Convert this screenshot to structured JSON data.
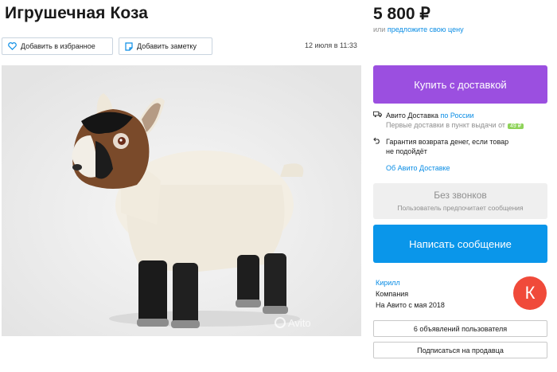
{
  "listing": {
    "title": "Игрушечная Коза",
    "price": "5 800 ₽",
    "offer_prefix": "или",
    "offer_link": "предложите свою цену",
    "date": "12 июля в 11:33",
    "photo_watermark": "Avito"
  },
  "actions": {
    "favorite_label": "Добавить в избранное",
    "note_label": "Добавить заметку",
    "buy_label": "Купить с доставкой",
    "message_label": "Написать сообщение"
  },
  "delivery": {
    "title": "Авито Доставка",
    "region_link": "по России",
    "first_delivery": "Первые доставки в пункт выдачи от",
    "first_delivery_badge": "49 ₽",
    "guarantee_line1": "Гарантия возврата денег, если товар",
    "guarantee_line2": "не подойдёт",
    "about_link": "Об Авито Доставке"
  },
  "no_calls": {
    "title": "Без звонков",
    "subtitle": "Пользователь предпочитает сообщения"
  },
  "seller": {
    "name": "Кирилл",
    "type": "Компания",
    "since": "На Авито с мая 2018",
    "avatar_letter": "К",
    "ads_label": "6 объявлений пользователя",
    "subscribe_label": "Подписаться на продавца"
  },
  "colors": {
    "buy_button": "#9b4fe0",
    "message_button": "#0a96ea",
    "link": "#0a8de5",
    "avatar": "#f04a3a"
  },
  "icons": [
    "heart-icon",
    "note-icon",
    "truck-icon",
    "return-icon"
  ]
}
